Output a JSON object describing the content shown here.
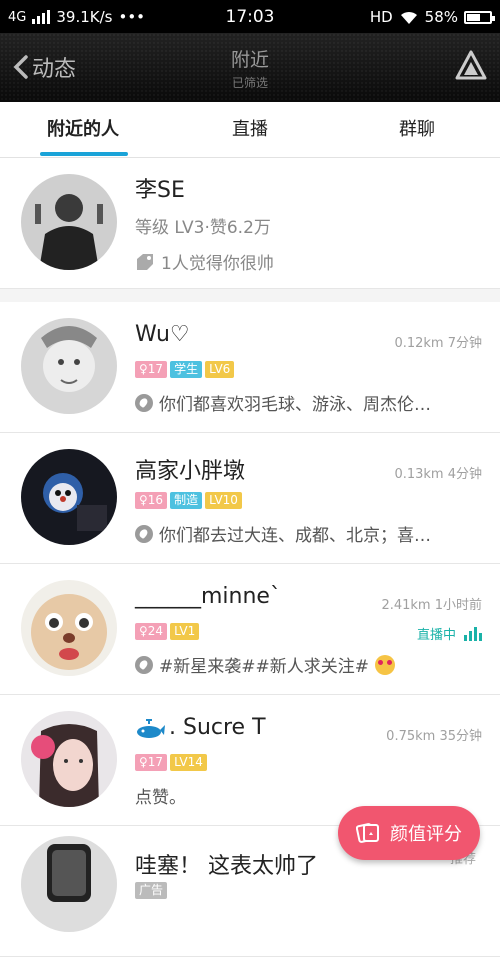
{
  "status_bar": {
    "network": "4G",
    "speed": "39.1K/s",
    "dots": "•••",
    "time": "17:03",
    "hd": "HD",
    "battery": "58%"
  },
  "header": {
    "back_label": "动态",
    "title": "附近",
    "subtitle": "已筛选"
  },
  "tabs": [
    {
      "label": "附近的人",
      "active": true
    },
    {
      "label": "直播",
      "active": false
    },
    {
      "label": "群聊",
      "active": false
    }
  ],
  "me": {
    "name": "李SE",
    "level_text": "等级 LV3·赞6.2万",
    "compliment": "1人觉得你很帅"
  },
  "people": [
    {
      "name": "Wu♡",
      "distance": "0.12km",
      "time": "7分钟",
      "tags": [
        "♀17",
        "学生",
        "LV6"
      ],
      "desc": "你们都喜欢羽毛球、游泳、周杰伦…"
    },
    {
      "name": "高家小胖墩",
      "distance": "0.13km",
      "time": "4分钟",
      "tags": [
        "♀16",
        "制造",
        "LV10"
      ],
      "desc": "你们都去过大连、成都、北京；喜…"
    },
    {
      "name": "______minne`",
      "distance": "2.41km",
      "time": "1小时前",
      "tags": [
        "♀24",
        "LV1"
      ],
      "desc": "#新星来袭##新人求关注#",
      "live": "直播中"
    },
    {
      "name": ". Sucre T",
      "distance": "0.75km",
      "time": "35分钟",
      "tags": [
        "♀17",
        "LV14"
      ],
      "desc": "点赞。"
    },
    {
      "name": "哇塞！ 这表太帅了",
      "distance": "",
      "time": "",
      "tags": [
        "广告"
      ],
      "desc": ""
    }
  ],
  "fab": {
    "label": "颜值评分",
    "partial_text": "推荐"
  }
}
